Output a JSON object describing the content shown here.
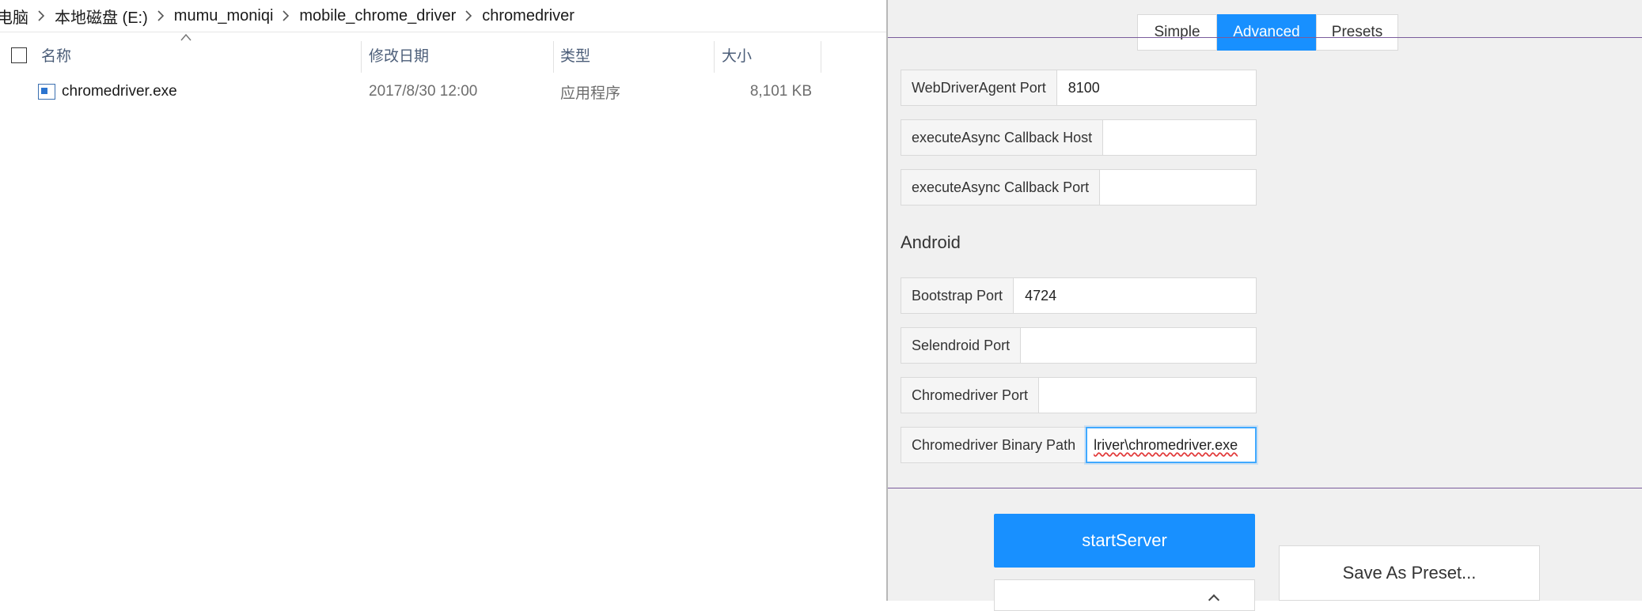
{
  "explorer": {
    "breadcrumb": [
      "电脑",
      "本地磁盘 (E:)",
      "mumu_moniqi",
      "mobile_chrome_driver",
      "chromedriver"
    ],
    "columns": {
      "name": "名称",
      "modified": "修改日期",
      "type": "类型",
      "size": "大小"
    },
    "files": [
      {
        "name": "chromedriver.exe",
        "modified": "2017/8/30 12:00",
        "type": "应用程序",
        "size": "8,101 KB",
        "icon": "exe-file-icon"
      }
    ]
  },
  "appium": {
    "tabs": [
      "Simple",
      "Advanced",
      "Presets"
    ],
    "active_tab": "Advanced",
    "ios_fields": [
      {
        "label": "WebDriverAgent Port",
        "value": "8100"
      },
      {
        "label": "executeAsync Callback Host",
        "value": ""
      },
      {
        "label": "executeAsync Callback Port",
        "value": ""
      }
    ],
    "android_title": "Android",
    "android_fields": [
      {
        "label": "Bootstrap Port",
        "value": "4724"
      },
      {
        "label": "Selendroid Port",
        "value": ""
      },
      {
        "label": "Chromedriver Port",
        "value": ""
      },
      {
        "label": "Chromedriver Binary Path",
        "value": "lriver\\chromedriver.exe"
      }
    ],
    "start_button": "startServer",
    "save_button": "Save As Preset...",
    "accent": "#1890ff"
  }
}
